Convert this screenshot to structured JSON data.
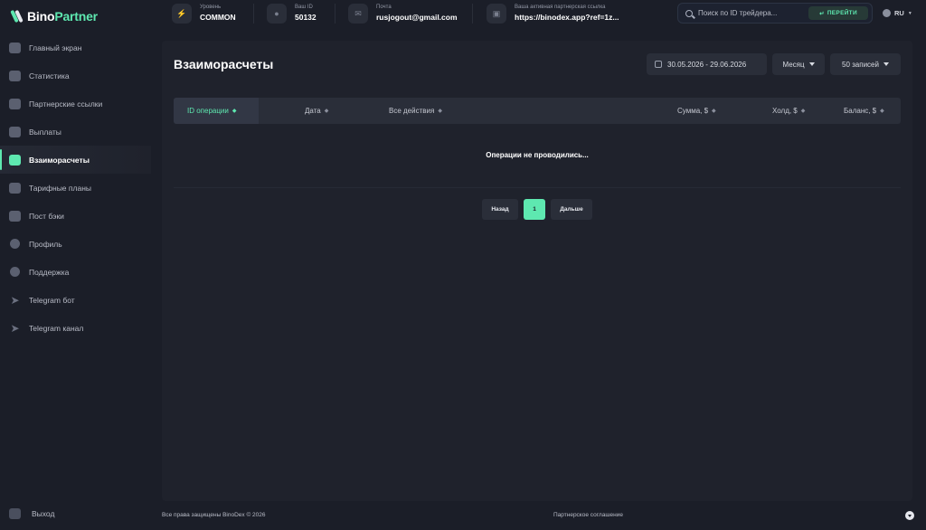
{
  "brand": {
    "part1": "Bino",
    "part2": "Partner"
  },
  "colors": {
    "accent": "#5ee8b0",
    "background": "#1b1e28",
    "panel": "#1f222c",
    "surface": "#2a2e39"
  },
  "sidebar": {
    "items": [
      {
        "label": "Главный экран",
        "icon": "home-icon"
      },
      {
        "label": "Статистика",
        "icon": "stats-icon"
      },
      {
        "label": "Партнерские ссылки",
        "icon": "link-icon"
      },
      {
        "label": "Выплаты",
        "icon": "wallet-icon"
      },
      {
        "label": "Взаиморасчеты",
        "icon": "exchange-icon",
        "active": true
      },
      {
        "label": "Тарифные планы",
        "icon": "plans-icon"
      },
      {
        "label": "Пост бэки",
        "icon": "postback-icon"
      },
      {
        "label": "Профиль",
        "icon": "user-icon"
      },
      {
        "label": "Поддержка",
        "icon": "support-icon"
      },
      {
        "label": "Telegram бот",
        "icon": "telegram-icon"
      },
      {
        "label": "Telegram канал",
        "icon": "telegram-icon"
      }
    ],
    "logout": "Выход"
  },
  "topbar": {
    "level": {
      "label": "Уровень",
      "value": "COMMON"
    },
    "id": {
      "label": "Ваш ID",
      "value": "50132"
    },
    "email": {
      "label": "Почта",
      "value": "rusjogout@gmail.com"
    },
    "ref": {
      "label": "Ваша активная партнерская ссылка",
      "value": "https://binodex.app?ref=1z..."
    },
    "search": {
      "placeholder": "Поиск по ID трейдера...",
      "button": "ПЕРЕЙТИ"
    },
    "language": "RU"
  },
  "main": {
    "title": "Взаиморасчеты",
    "date_range": "30.05.2026 - 29.06.2026",
    "period": "Месяц",
    "records": "50 записей",
    "columns": [
      "ID операции",
      "Дата",
      "Все действия",
      "Сумма, $",
      "Холд, $",
      "Баланс, $"
    ],
    "empty": "Операции не проводились...",
    "pagination": {
      "prev": "Назад",
      "current": "1",
      "next": "Дальше"
    }
  },
  "footer": {
    "copyright": "Все права защищены BinoDex © 2026",
    "agreement": "Партнерское соглашение"
  }
}
